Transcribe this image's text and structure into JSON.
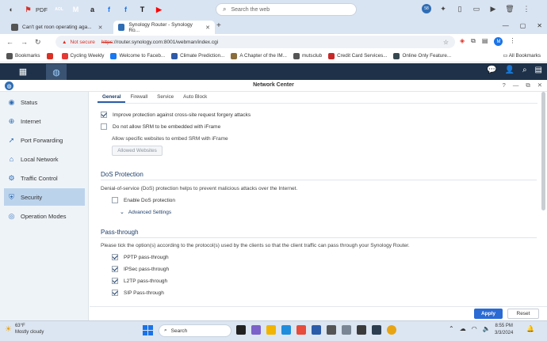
{
  "browser": {
    "extensions": [
      {
        "name": "media-icon",
        "label": "",
        "color": "#3b3b3b",
        "glyph": "◐"
      },
      {
        "name": "pdf-icon",
        "label": "PDF",
        "color": "#d93025",
        "glyph": "⚑"
      },
      {
        "name": "aol-icon",
        "label": "",
        "color": "#ffffff",
        "glyph": "AOL"
      },
      {
        "name": "gmail-icon",
        "label": "",
        "color": "#ffffff",
        "glyph": "M"
      },
      {
        "name": "amazon-icon",
        "label": "",
        "color": "#222222",
        "glyph": "a"
      },
      {
        "name": "facebook-icon",
        "label": "",
        "color": "#1877f2",
        "glyph": "f"
      },
      {
        "name": "facebook-icon-2",
        "label": "",
        "color": "#1877f2",
        "glyph": "f"
      },
      {
        "name": "nyt-icon",
        "label": "",
        "color": "#111111",
        "glyph": "T"
      },
      {
        "name": "youtube-icon",
        "label": "",
        "color": "#ff0000",
        "glyph": "▶"
      }
    ],
    "search_placeholder": "Search the web",
    "ext_badge": "58",
    "tabs": [
      {
        "title": "Can't get roon operating aga...",
        "active": false
      },
      {
        "title": "Synology Router - Synology Ro...",
        "active": true
      }
    ],
    "address": {
      "security": "Not secure",
      "proto": "https",
      "rest": "://router.synology.com:8001/webman/index.cgi"
    },
    "profile_initial": "M",
    "bookmarks": [
      {
        "label": "Bookmarks",
        "color": "#555555"
      },
      {
        "label": "",
        "color": "#d93025"
      },
      {
        "label": "Cycling Weekly",
        "color": "#e53935"
      },
      {
        "label": "Welcome to Faceb...",
        "color": "#1877f2"
      },
      {
        "label": "Climate Prediction...",
        "color": "#2e5aa8"
      },
      {
        "label": "A Chapter of the IM...",
        "color": "#8a6d3b"
      },
      {
        "label": "mutsclub",
        "color": "#555555"
      },
      {
        "label": "Credit Card Services...",
        "color": "#c62828"
      },
      {
        "label": "Online Only Feature...",
        "color": "#37474f"
      }
    ],
    "all_bookmarks": "All Bookmarks"
  },
  "dsm": {
    "window_title": "Network Center",
    "sidebar": [
      {
        "label": "Status",
        "icon": "status-icon",
        "glyph": "◉",
        "active": false
      },
      {
        "label": "Internet",
        "icon": "globe-icon",
        "glyph": "⊕",
        "active": false
      },
      {
        "label": "Port Forwarding",
        "icon": "port-forwarding-icon",
        "glyph": "➚",
        "active": false
      },
      {
        "label": "Local Network",
        "icon": "local-network-icon",
        "glyph": "⌂",
        "active": false
      },
      {
        "label": "Traffic Control",
        "icon": "traffic-control-icon",
        "glyph": "⚙",
        "active": false
      },
      {
        "label": "Security",
        "icon": "shield-icon",
        "glyph": "⛨",
        "active": true
      },
      {
        "label": "Operation Modes",
        "icon": "operation-modes-icon",
        "glyph": "◎",
        "active": false
      }
    ],
    "tabs": [
      "General",
      "Firewall",
      "Service",
      "Auto Block"
    ],
    "general": {
      "forgery": "Improve protection against cross-site request forgery attacks",
      "iframe": "Do not allow SRM to be embedded with iFrame",
      "allow_sites": "Allow specific websites to embed SRM with iFrame",
      "allowed_btn": "Allowed Websites"
    },
    "dos": {
      "title": "DoS Protection",
      "desc": "Denial-of-service (DoS) protection helps to prevent malicious attacks over the Internet.",
      "enable": "Enable DoS protection",
      "advanced": "Advanced Settings"
    },
    "pass": {
      "title": "Pass-through",
      "desc": "Please tick the option(s) according to the protocol(s) used by the clients so that the client traffic can pass through your Synology Router.",
      "options": [
        "PPTP pass-through",
        "IPSec pass-through",
        "L2TP pass-through",
        "SIP Pass-through"
      ]
    },
    "apply": "Apply",
    "reset": "Reset"
  },
  "taskbar": {
    "temp": "63°F",
    "condition": "Mostly cloudy",
    "search": "Search",
    "time": "8:55 PM",
    "date": "3/3/2024"
  }
}
